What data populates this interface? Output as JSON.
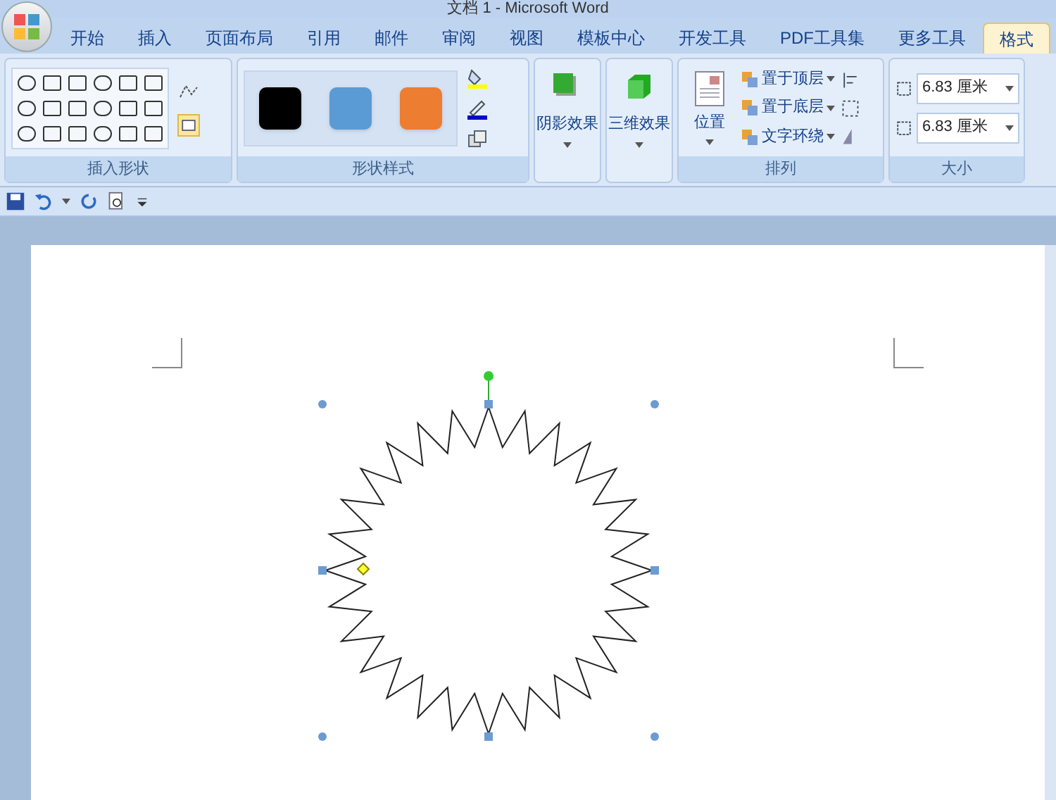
{
  "window": {
    "title": "文档 1 - Microsoft Word"
  },
  "tabs": [
    {
      "label": "开始",
      "selected": false
    },
    {
      "label": "插入",
      "selected": false
    },
    {
      "label": "页面布局",
      "selected": false
    },
    {
      "label": "引用",
      "selected": false
    },
    {
      "label": "邮件",
      "selected": false
    },
    {
      "label": "审阅",
      "selected": false
    },
    {
      "label": "视图",
      "selected": false
    },
    {
      "label": "模板中心",
      "selected": false
    },
    {
      "label": "开发工具",
      "selected": false
    },
    {
      "label": "PDF工具集",
      "selected": false
    },
    {
      "label": "更多工具",
      "selected": false
    },
    {
      "label": "格式",
      "selected": true
    }
  ],
  "groups": {
    "insert_shapes": "插入形状",
    "shape_styles": {
      "label": "形状样式",
      "swatches": [
        {
          "color": "#000000"
        },
        {
          "color": "#5a9bd5"
        },
        {
          "color": "#ed7d31"
        }
      ]
    },
    "shadow": "阴影效果",
    "three_d": "三维效果",
    "arrange": {
      "label": "排列",
      "position": "位置",
      "bring_front": "置于顶层",
      "send_back": "置于底层",
      "wrap": "文字环绕"
    },
    "size": {
      "label": "大小",
      "height": "6.83 厘米",
      "width": "6.83 厘米"
    }
  }
}
